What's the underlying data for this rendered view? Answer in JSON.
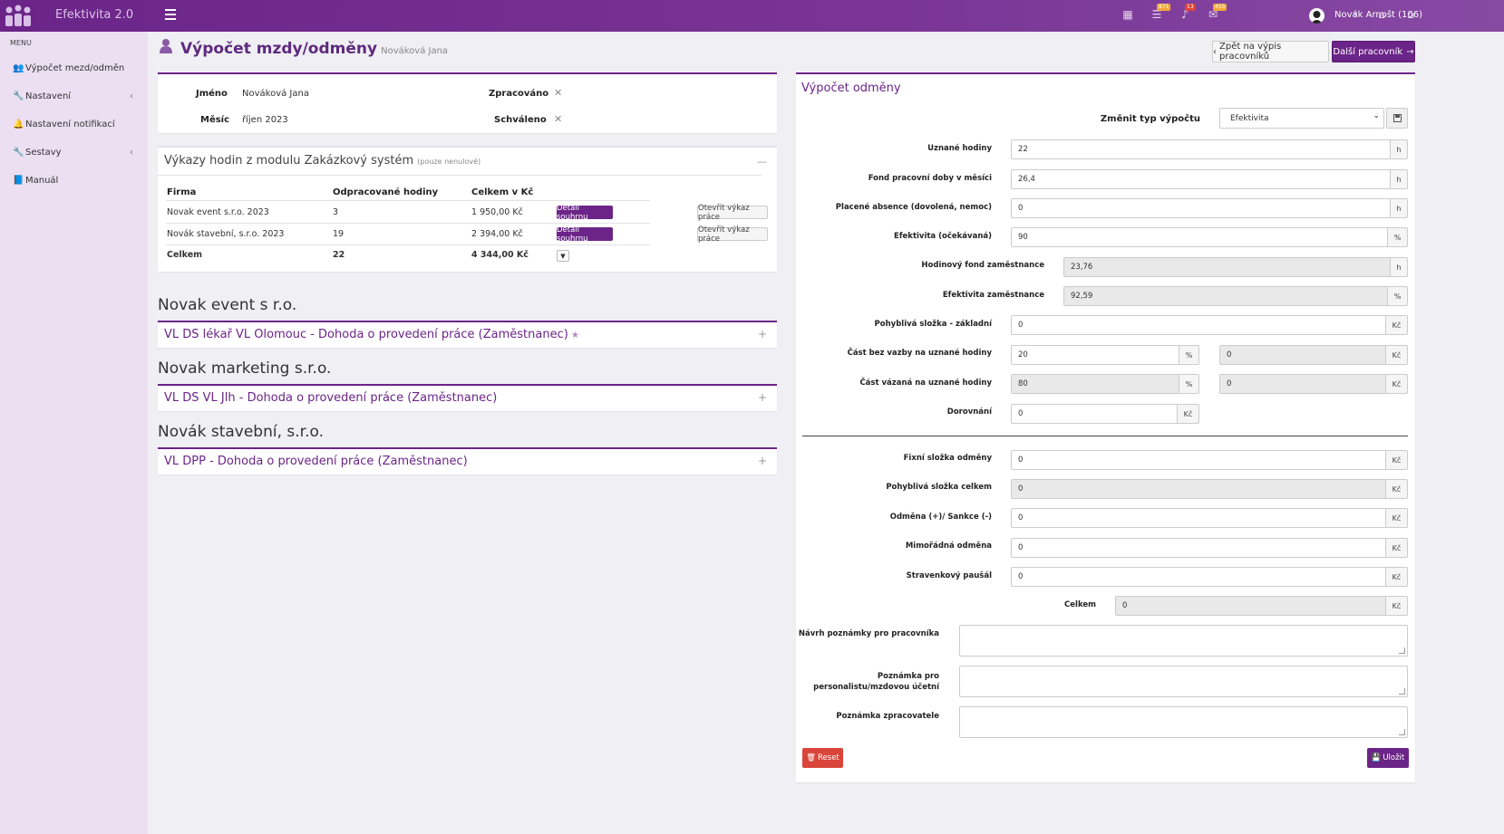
{
  "app": {
    "title": "Efektivita 2.0",
    "user": "Novák Arnošt (106)",
    "badges": {
      "tasks": "871",
      "bell": "13",
      "messages": "455"
    },
    "accent": "#6b2488"
  },
  "sidebar": {
    "header": "MENU",
    "items": [
      {
        "label": "Výpočet mezd/odměn",
        "icon": "users-icon"
      },
      {
        "label": "Nastavení",
        "icon": "wrench-icon"
      },
      {
        "label": "Nastavení notifikací",
        "icon": "bell-icon"
      },
      {
        "label": "Sestavy",
        "icon": "wrench-icon"
      },
      {
        "label": "Manuál",
        "icon": "book-icon"
      }
    ]
  },
  "page": {
    "title": "Výpočet mzdy/odměny",
    "subtitle": "Nováková Jana",
    "back_button": "Zpět na výpis pracovníků",
    "next_button": "Další pracovník"
  },
  "info": {
    "name_label": "Jméno",
    "name_value": "Nováková Jana",
    "month_label": "Měsíc",
    "month_value": "říjen 2023",
    "processed_label": "Zpracováno",
    "approved_label": "Schváleno"
  },
  "hours": {
    "title": "Výkazy hodin z modulu Zakázkový systém",
    "note": "(pouze nenulové)",
    "columns": [
      "Firma",
      "Odpracované hodiny",
      "Celkem v Kč"
    ],
    "rows": [
      {
        "firm": "Novak event s.r.o. 2023",
        "hours": "3",
        "total": "1 950,00 Kč",
        "detail": "Detail souhrnu",
        "open": "Otevřít výkaz práce"
      },
      {
        "firm": "Novák stavební, s.r.o. 2023",
        "hours": "19",
        "total": "2 394,00 Kč",
        "detail": "Detail souhrnu",
        "open": "Otevřít výkaz práce"
      }
    ],
    "sum": {
      "label": "Celkem",
      "hours": "22",
      "total": "4 344,00 Kč"
    }
  },
  "companies": [
    {
      "name": "Novak event s r.o.",
      "contract": "VL DS lékař VL Olomouc - Dohoda o provedení práce (Zaměstnanec)"
    },
    {
      "name": "Novak marketing s.r.o.",
      "contract": "VL DS VL Jlh - Dohoda o provedení práce (Zaměstnanec)"
    },
    {
      "name": "Novák stavební, s.r.o.",
      "contract": "VL DPP - Dohoda o provedení práce (Zaměstnanec)"
    }
  ],
  "calc": {
    "title": "Výpočet odměny",
    "type_label": "Změnit typ výpočtu",
    "type_value": "Efektivita",
    "fields": {
      "uznane_hodiny": {
        "label": "Uznané hodiny",
        "value": "22",
        "unit": "h"
      },
      "fond": {
        "label": "Fond pracovní doby v měsíci",
        "value": "26,4",
        "unit": "h"
      },
      "absence": {
        "label": "Placené absence (dovolená, nemoc)",
        "value": "0",
        "unit": "h"
      },
      "efektivita_ocek": {
        "label": "Efektivita (očekávaná)",
        "value": "90",
        "unit": "%"
      },
      "hod_fond": {
        "label": "Hodinový fond zaměstnance",
        "value": "23,76",
        "unit": "h"
      },
      "efektivita_zam": {
        "label": "Efektivita zaměstnance",
        "value": "92,59",
        "unit": "%"
      },
      "pohybliva_zakl": {
        "label": "Pohyblivá složka - základní",
        "value": "0",
        "unit": "Kč"
      },
      "bez_vazby": {
        "label": "Část bez vazby na uznané hodiny",
        "value": "20",
        "unit": "%",
        "value2": "0",
        "unit2": "Kč"
      },
      "vazana": {
        "label": "Část vázaná na uznané hodiny",
        "value": "80",
        "unit": "%",
        "value2": "0",
        "unit2": "Kč"
      },
      "dorovnani": {
        "label": "Dorovnání",
        "value": "0",
        "unit": "Kč"
      },
      "fixni": {
        "label": "Fixní složka odměny",
        "value": "0",
        "unit": "Kč"
      },
      "pohybliva_celkem": {
        "label": "Pohyblivá složka celkem",
        "value": "0",
        "unit": "Kč"
      },
      "odmena_sankce": {
        "label": "Odměna (+)/ Sankce (-)",
        "value": "0",
        "unit": "Kč"
      },
      "mimoradna": {
        "label": "Mimořádná odměna",
        "value": "0",
        "unit": "Kč"
      },
      "stravenkovy": {
        "label": "Stravenkový paušál",
        "value": "0",
        "unit": "Kč"
      },
      "celkem": {
        "label": "Celkem",
        "value": "0",
        "unit": "Kč"
      }
    },
    "note_worker_label": "Návrh poznámky pro pracovníka",
    "note_hr_label": "Poznámka pro personalistu/mzdovou účetní",
    "note_proc_label": "Poznámka zpracovatele",
    "reset_button": "Reset",
    "save_button": "Uložit"
  }
}
